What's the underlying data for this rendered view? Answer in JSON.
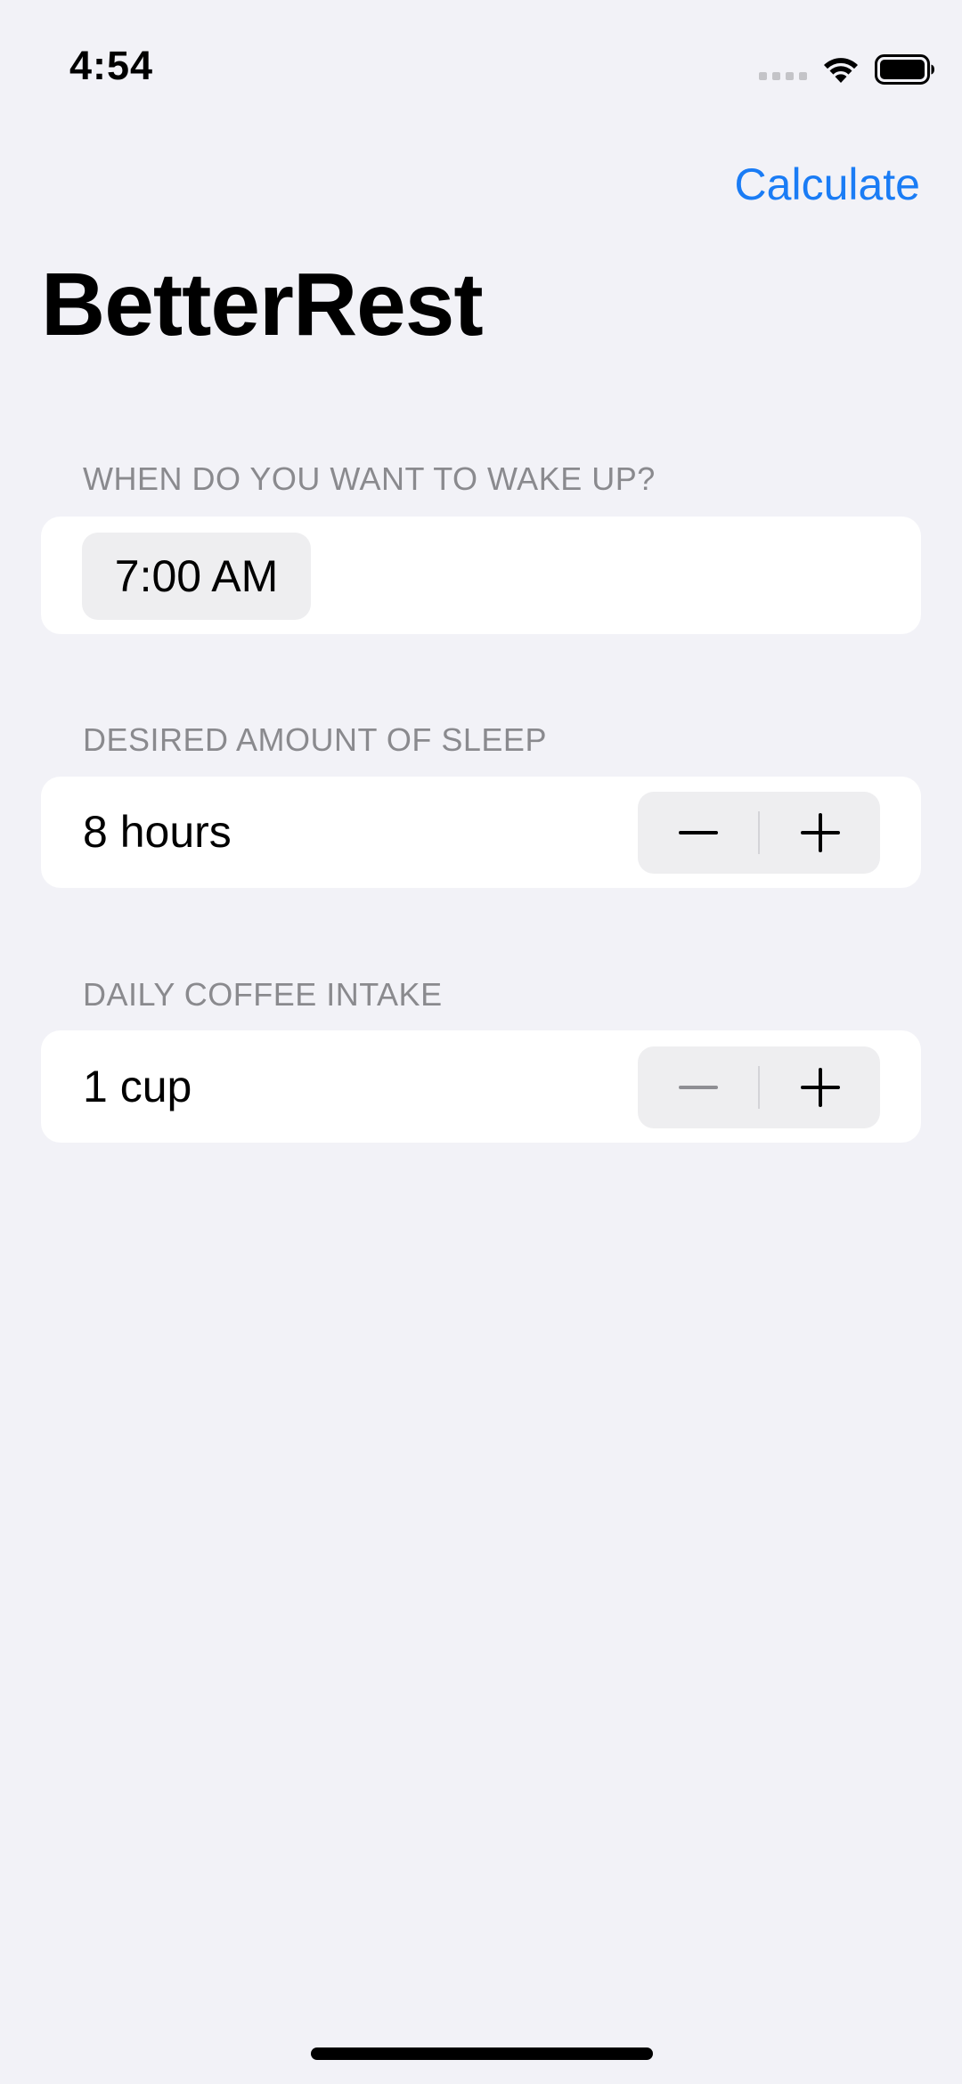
{
  "status_bar": {
    "time": "4:54"
  },
  "toolbar": {
    "calculate_label": "Calculate"
  },
  "title": "BetterRest",
  "sections": {
    "wake": {
      "header": "WHEN DO YOU WANT TO WAKE UP?",
      "time_value": "7:00 AM"
    },
    "sleep": {
      "header": "DESIRED AMOUNT OF SLEEP",
      "value_label": "8 hours",
      "decrement_enabled": true,
      "increment_enabled": true
    },
    "coffee": {
      "header": "DAILY COFFEE INTAKE",
      "value_label": "1 cup",
      "decrement_enabled": false,
      "increment_enabled": true
    }
  },
  "colors": {
    "accent": "#1a7cf5",
    "background": "#f2f2f7",
    "card": "#ffffff",
    "secondary_text": "#8a8a8e"
  },
  "icons": {
    "signal": "cellular-signal-icon",
    "wifi": "wifi-icon",
    "battery": "battery-icon",
    "minus": "minus-icon",
    "plus": "plus-icon"
  }
}
